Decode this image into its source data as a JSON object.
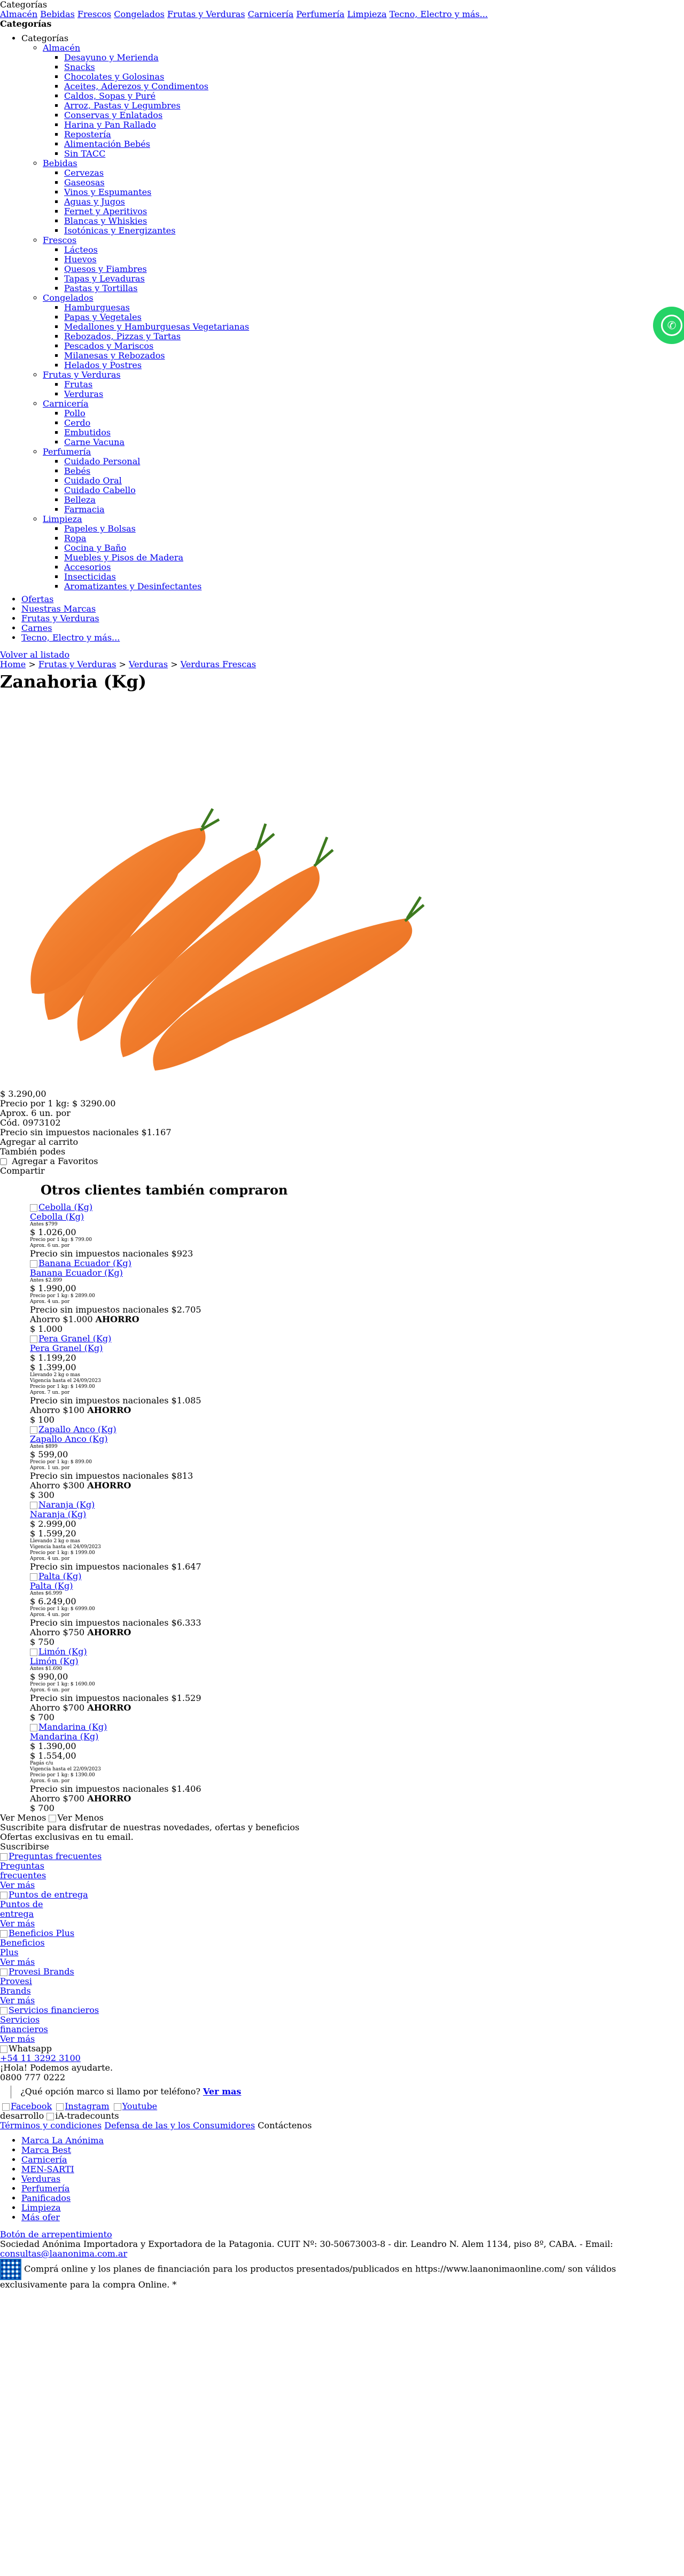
{
  "header": {
    "categories_label": "Categorías",
    "top_links": [
      "Almacén",
      "Bebidas",
      "Frescos",
      "Congelados",
      "Frutas y Verduras",
      "Carnicería",
      "Perfumería",
      "Limpieza",
      "Tecno, Electro y más..."
    ],
    "categories_heading": "Categorías",
    "tree_root": "Categorías",
    "tree": [
      {
        "label": "Almacén",
        "items": [
          "Desayuno y Merienda",
          "Snacks",
          "Chocolates y Golosinas",
          "Aceites, Aderezos y Condimentos",
          "Caldos, Sopas y Puré",
          "Arroz, Pastas y Legumbres",
          "Conservas y Enlatados",
          "Harina y Pan Rallado",
          "Repostería",
          "Alimentación Bebés",
          "Sin TACC"
        ]
      },
      {
        "label": "Bebidas",
        "items": [
          "Cervezas",
          "Gaseosas",
          "Vinos y Espumantes",
          "Aguas y Jugos",
          "Fernet y Aperitivos",
          "Blancas y Whiskies",
          "Isotónicas y Energizantes"
        ]
      },
      {
        "label": "Frescos",
        "items": [
          "Lácteos",
          "Huevos",
          "Quesos y Fiambres",
          "Tapas y Levaduras",
          "Pastas y Tortillas"
        ]
      },
      {
        "label": "Congelados",
        "items": [
          "Hamburguesas",
          "Papas y Vegetales",
          "Medallones y Hamburguesas Vegetarianas",
          "Rebozados, Pizzas y Tartas",
          "Pescados y Mariscos",
          "Milanesas y Rebozados",
          "Helados y Postres"
        ]
      },
      {
        "label": "Frutas y Verduras",
        "items": [
          "Frutas",
          "Verduras"
        ]
      },
      {
        "label": "Carnicería",
        "items": [
          "Pollo",
          "Cerdo",
          "Embutidos",
          "Carne Vacuna"
        ]
      },
      {
        "label": "Perfumería",
        "items": [
          "Cuidado Personal",
          "Bebés",
          "Cuidado Oral",
          "Cuidado Cabello",
          "Belleza",
          "Farmacia"
        ]
      },
      {
        "label": "Limpieza",
        "items": [
          "Papeles y Bolsas",
          "Ropa",
          "Cocina y Baño",
          "Muebles y Pisos de Madera",
          "Accesorios",
          "Insecticidas",
          "Aromatizantes y Desinfectantes"
        ]
      }
    ],
    "extra_links": [
      "Ofertas",
      "Nuestras Marcas",
      "Frutas y Verduras",
      "Carnes",
      "Tecno, Electro y más..."
    ]
  },
  "breadcrumb": {
    "back": "Volver al listado",
    "items": [
      "Home",
      "Frutas y Verduras",
      "Verduras",
      "Verduras Frescas"
    ]
  },
  "product": {
    "title": "Zanahoria (Kg)",
    "price": "$ 3.290,00",
    "price_per": "Precio por 1 kg: $ 3290.00",
    "approx": "Aprox. 6 un. por",
    "cod": "Cód. 0973102",
    "tax_note": "Precio sin impuestos nacionales $1.167",
    "add_cart": "Agregar al carrito",
    "also_like": "También podes",
    "favorites": "Agregar a Favoritos",
    "share": "Compartir"
  },
  "related": {
    "title": "Otros clientes también compraron",
    "items": [
      {
        "name": "Cebolla (Kg)",
        "img_alt": "Cebolla (Kg)",
        "antes": "Antes $799",
        "price": "$ 1.026,00",
        "per": "Precio por 1 kg: $ 799.00",
        "approx": "Aprox. 6 un. por",
        "tax": "Precio sin impuestos nacionales $923",
        "ahorro": "",
        "ahorro_amt": "",
        "extra": ""
      },
      {
        "name": "Banana Ecuador (Kg)",
        "img_alt": "Banana Ecuador (Kg)",
        "antes": "Antes $2.899",
        "price": "$ 1.990,00",
        "per": "Precio por 1 kg: $ 2899.00",
        "approx": "Aprox. 4 un. por",
        "tax": "Precio sin impuestos nacionales $2.705",
        "ahorro": "Ahorro $1.000",
        "ahorro_amt": "$ 1.000",
        "extra": ""
      },
      {
        "name": "Pera Granel (Kg)",
        "img_alt": "Pera Granel (Kg)",
        "antes": "",
        "price": "$ 1.199,20",
        "price2": "$ 1.399,00",
        "per": "Llevando 2 kg o mas",
        "per2": "Vigencia hasta el 24/09/2023",
        "per3": "Precio por 1 kg: $ 1499.00",
        "approx": "Aprox. 7 un. por",
        "tax": "Precio sin impuestos nacionales $1.085",
        "ahorro": "Ahorro $100",
        "ahorro_amt": "$ 100",
        "extra": ""
      },
      {
        "name": "Zapallo Anco (Kg)",
        "img_alt": "Zapallo Anco (Kg)",
        "antes": "Antes $899",
        "price": "$ 599,00",
        "per": "Precio por 1 kg: $ 899.00",
        "approx": "Aprox. 1 un. por",
        "tax": "Precio sin impuestos nacionales $813",
        "ahorro": "Ahorro $300",
        "ahorro_amt": "$ 300",
        "extra": ""
      },
      {
        "name": "Naranja (Kg)",
        "img_alt": "Naranja (Kg)",
        "antes": "",
        "price": "$ 2.999,00",
        "price2": "$ 1.599,20",
        "per": "Llevando 2 kg o mas",
        "per2": "Vigencia hasta el 24/09/2023",
        "per3": "Precio por 1 kg: $ 1999.00",
        "approx": "Aprox. 4 un. por",
        "tax": "Precio sin impuestos nacionales $1.647",
        "ahorro": "",
        "ahorro_amt": "",
        "extra": ""
      },
      {
        "name": "Palta (Kg)",
        "img_alt": "Palta (Kg)",
        "antes": "Antes $6.999",
        "price": "$ 6.249,00",
        "per": "Precio por 1 kg: $ 6999.00",
        "approx": "Aprox. 4 un. por",
        "tax": "Precio sin impuestos nacionales $6.333",
        "ahorro": "Ahorro $750",
        "ahorro_amt": "$ 750",
        "extra": ""
      },
      {
        "name": "Limón (Kg)",
        "img_alt": "Limón (Kg)",
        "antes": "Antes $1.690",
        "price": "$ 990,00",
        "per": "Precio por 1 kg: $ 1690.00",
        "approx": "Aprox. 6 un. por",
        "tax": "Precio sin impuestos nacionales $1.529",
        "ahorro": "Ahorro $700",
        "ahorro_amt": "$ 700",
        "extra": ""
      },
      {
        "name": "Mandarina (Kg)",
        "img_alt": "Mandarina (Kg)",
        "antes": "",
        "price": "$ 1.390,00",
        "price2": "$ 1.554,00",
        "per": "Pagás c/u",
        "per2": "Vigencia hasta el 22/09/2023",
        "per3": "Precio por 1 kg: $ 1390.00",
        "approx": "Aprox. 6 un. por",
        "tax": "Precio sin impuestos nacionales $1.406",
        "ahorro": "Ahorro $700",
        "ahorro_amt": "$ 700",
        "extra": ""
      }
    ]
  },
  "newsletter": {
    "ver_menos": "Ver Menos",
    "ver_menos_img": "Ver Menos",
    "line1": "Suscribite para disfrutar de nuestras novedades, ofertas y beneficios",
    "line2": "Ofertas exclusivas en tu email.",
    "subscribe": "Suscribirse"
  },
  "features": [
    {
      "img": "Preguntas frecuentes",
      "l1": "Preguntas",
      "l2": "frecuentes",
      "more": "Ver más"
    },
    {
      "img": "Puntos de entrega",
      "l1": "Puntos de",
      "l2": "entrega",
      "more": "Ver más"
    },
    {
      "img": "Beneficios Plus",
      "l1": "Beneficios",
      "l2": "Plus",
      "more": "Ver más"
    },
    {
      "img": "Provesi Brands",
      "l1": "Provesi",
      "l2": "Brands",
      "more": "Ver más"
    },
    {
      "img": "Servicios financieros",
      "l1": "Servicios",
      "l2": "financieros",
      "more": "Ver más"
    }
  ],
  "contact": {
    "whatsapp_alt": "Whatsapp",
    "whatsapp_num": "+54 11 3292 3100",
    "hello": "¡Hola! Podemos ayudarte.",
    "phone": "0800 777 0222",
    "question": "¿Qué opción marco si llamo por teléfono?",
    "see_more": "Ver mas",
    "social": [
      "Facebook",
      "Instagram",
      "Youtube"
    ],
    "dev": "desarrollo",
    "dev_img": "iA-tradecounts"
  },
  "legal": {
    "links": [
      "Términos y condiciones",
      "Defensa de las y los Consumidores"
    ],
    "contact": "Contáctenos"
  },
  "brands": [
    "Marca La Anónima",
    "Marca Best",
    "Carnicería",
    "MEN-SARTI",
    "Verduras",
    "Perfumería",
    "Panificados",
    "Limpieza",
    "Más ofer"
  ],
  "footer": {
    "arrepentimiento": "Botón de arrepentimiento",
    "company": "Sociedad Anónima Importadora y Exportadora de la Patagonia. CUIT Nº: 30-50673003-8 - dir. Leandro N. Alem 1134, piso 8º, CABA. - Email:",
    "email": "consultas@laanonima.com.ar",
    "note": "Comprá online y los planes de financiación para los productos presentados/publicados en https://www.laanonimaonline.com/ son válidos exclusivamente para la compra Online. *"
  },
  "colors": {
    "whatsapp": "#25d366",
    "link": "#0000ee",
    "carrot": "#f07a2a"
  }
}
